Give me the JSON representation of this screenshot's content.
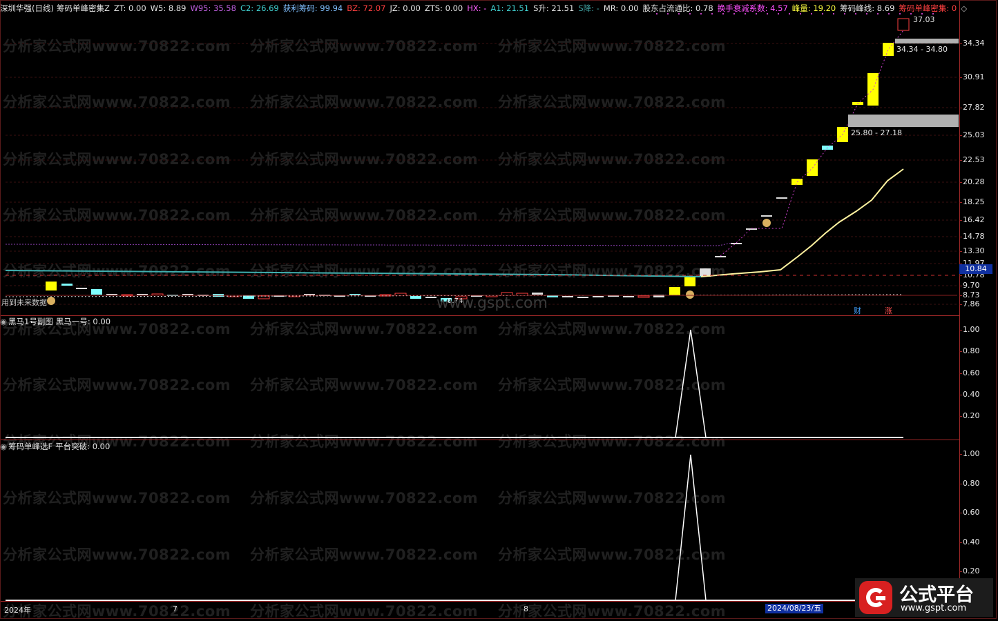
{
  "main": {
    "indicators": [
      {
        "label": "深圳华强(日线)",
        "color": "#e6e6e6"
      },
      {
        "label": "筹码单峰密集Z",
        "color": "#e6e6e6"
      },
      {
        "label": "ZT: 0.00",
        "color": "#e6e6e6"
      },
      {
        "label": "W5: 8.89",
        "color": "#e6e6e6"
      },
      {
        "label": "W95: 35.58",
        "color": "#c060e0"
      },
      {
        "label": "C2: 26.69",
        "color": "#40d0d0"
      },
      {
        "label": "获利筹码: 99.94",
        "color": "#80c0ff"
      },
      {
        "label": "BZ: 72.07",
        "color": "#ff4040"
      },
      {
        "label": "JZ: 0.00",
        "color": "#e6e6e6"
      },
      {
        "label": "ZTS: 0.00",
        "color": "#e6e6e6"
      },
      {
        "label": "HX: -",
        "color": "#ff60ff"
      },
      {
        "label": "A1: 21.51",
        "color": "#40d0d0"
      },
      {
        "label": "S升: 21.51",
        "color": "#e6e6e6"
      },
      {
        "label": "S降: -",
        "color": "#40a0a0"
      },
      {
        "label": "MR: 0.00",
        "color": "#e6e6e6"
      },
      {
        "label": "股东占流通比: 0.78",
        "color": "#e6e6e6"
      },
      {
        "label": "换手衰减系数: 4.57",
        "color": "#ff50ff"
      },
      {
        "label": "峰量: 19.20",
        "color": "#ffff40"
      },
      {
        "label": "筹码峰线: 8.69",
        "color": "#e6e6e6"
      },
      {
        "label": "筹码单峰密集: 0",
        "color": "#ff4040"
      }
    ],
    "y_ticks": [
      "34.34",
      "30.91",
      "27.82",
      "25.03",
      "22.53",
      "20.28",
      "18.25",
      "16.42",
      "14.78",
      "13.30",
      "11.97",
      "10.78",
      "9.70",
      "8.73",
      "7.86"
    ],
    "current_price_tag": "10.84",
    "max_price_label": "37.03",
    "min_price_label": "8.74",
    "zone_upper_label": "34.34 - 34.80",
    "zone_lower_label": "25.80 - 27.18",
    "future_data_note": "用到未来数据",
    "badge_cai": "财",
    "badge_zhang": "涨",
    "site_watermark": "www.gspt.com"
  },
  "sub1": {
    "title": "黑马1号副图",
    "value_label": "黑马一号: 0.00",
    "y_ticks": [
      "1.00",
      "0.80",
      "0.60",
      "0.40",
      "0.20"
    ]
  },
  "sub2": {
    "title": "筹码单峰选F",
    "value_label": "平台突破: 0.00",
    "y_ticks": [
      "1.00",
      "0.80",
      "0.60",
      "0.40",
      "0.20"
    ]
  },
  "xaxis": {
    "labels": [
      "2024年",
      "7",
      "8"
    ],
    "cursor_date": "2024/08/23/五"
  },
  "watermark_text": "分析家公式网www.70822.com",
  "logo": {
    "title": "公式平台",
    "url": "www.gspt.com",
    "icon": "g-logo-icon"
  },
  "colors": {
    "up": "#ffff00",
    "down": "#7fffff",
    "frame": "#a32828",
    "ma": "#fff7a0"
  }
}
